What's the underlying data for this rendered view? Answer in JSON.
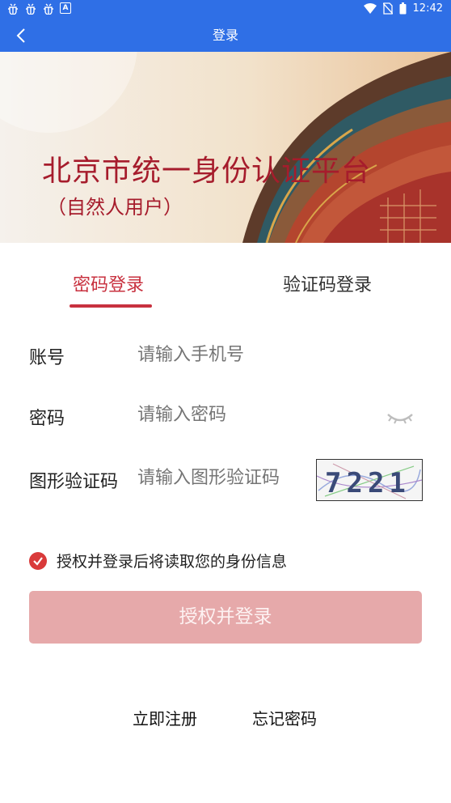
{
  "status_bar": {
    "time": "12:42",
    "battery_text": "",
    "icons": [
      "bug-icon",
      "bug-icon",
      "bug-icon",
      "accessibility-a-icon",
      "wifi-icon",
      "no-sim-icon",
      "battery-icon"
    ]
  },
  "nav": {
    "title": "登录",
    "back_icon": "chevron-left-icon"
  },
  "banner": {
    "title": "北京市统一身份认证平台",
    "subtitle": "（自然人用户）"
  },
  "tabs": [
    {
      "label": "密码登录",
      "active": true
    },
    {
      "label": "验证码登录",
      "active": false
    }
  ],
  "form": {
    "account_label": "账号",
    "account_placeholder": "请输入手机号",
    "password_label": "密码",
    "password_placeholder": "请输入密码",
    "captcha_label": "图形验证码",
    "captcha_placeholder": "请输入图形验证码",
    "captcha_text": "7221"
  },
  "agreement": {
    "checked": true,
    "text": "授权并登录后将读取您的身份信息"
  },
  "login_button": "授权并登录",
  "links": {
    "register": "立即注册",
    "forgot": "忘记密码"
  },
  "colors": {
    "primary_blue": "#2f6fe6",
    "accent_red": "#c8313f",
    "button_disabled": "#e6a9aa"
  }
}
